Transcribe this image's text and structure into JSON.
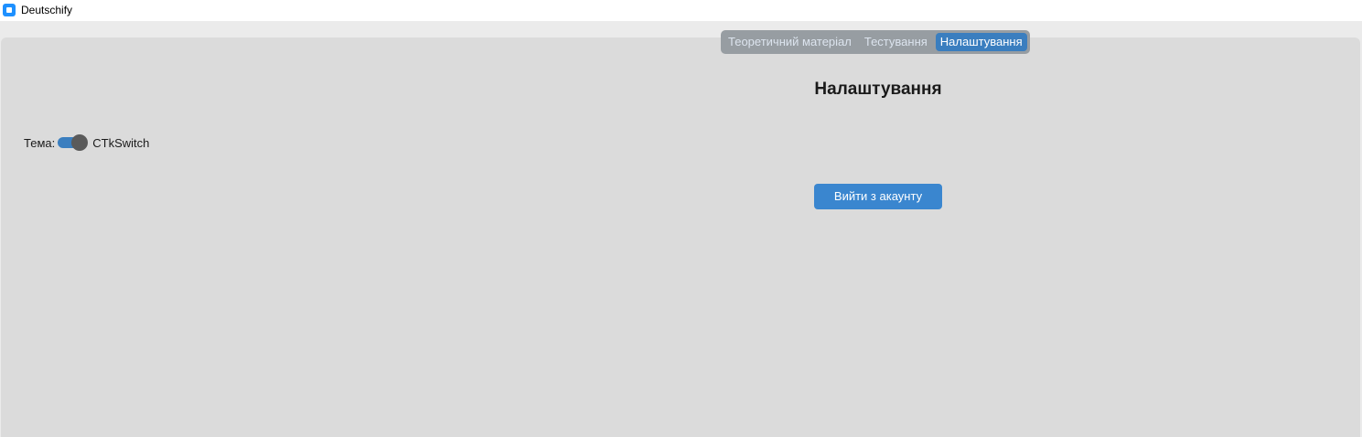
{
  "window": {
    "title": "Deutschify",
    "icon": "app-icon"
  },
  "tabs": [
    {
      "label": "Теоретичний матеріал",
      "selected": false
    },
    {
      "label": "Тестування",
      "selected": false
    },
    {
      "label": "Налаштування",
      "selected": true
    }
  ],
  "settings": {
    "title": "Налаштування",
    "theme_label": "Тема:",
    "theme_switch": {
      "text": "CTkSwitch",
      "on": true
    },
    "logout_label": "Вийти з акаунту"
  },
  "colors": {
    "accent": "#3a7ebf",
    "segmented_bg": "#979da2",
    "frame_bg": "#dbdbdb",
    "window_bg": "#ebebeb"
  }
}
